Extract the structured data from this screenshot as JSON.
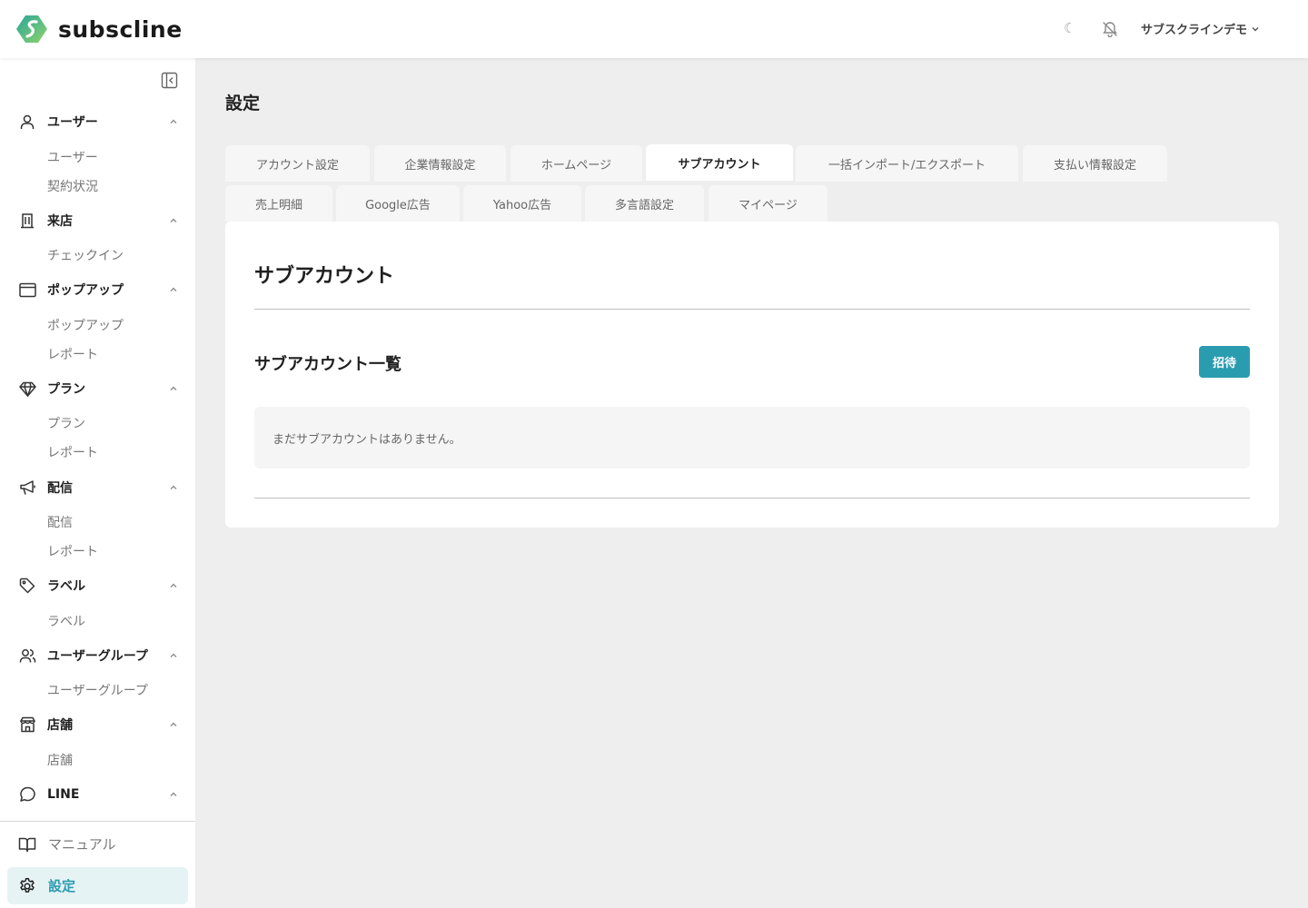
{
  "app": {
    "brand": "subscline",
    "theme_icon": "moon-icon",
    "notification_icon": "bell-off-icon",
    "account_name": "サブスクラインデモ"
  },
  "sidebar": {
    "sections": [
      {
        "icon": "user-icon",
        "label": "ユーザー",
        "items": [
          "ユーザー",
          "契約状況"
        ]
      },
      {
        "icon": "building-icon",
        "label": "来店",
        "items": [
          "チェックイン"
        ]
      },
      {
        "icon": "window-icon",
        "label": "ポップアップ",
        "items": [
          "ポップアップ",
          "レポート"
        ]
      },
      {
        "icon": "gem-icon",
        "label": "プラン",
        "items": [
          "プラン",
          "レポート"
        ]
      },
      {
        "icon": "megaphone-icon",
        "label": "配信",
        "items": [
          "配信",
          "レポート"
        ]
      },
      {
        "icon": "tag-icon",
        "label": "ラベル",
        "items": [
          "ラベル"
        ]
      },
      {
        "icon": "users-icon",
        "label": "ユーザーグループ",
        "items": [
          "ユーザーグループ"
        ]
      },
      {
        "icon": "store-icon",
        "label": "店舗",
        "items": [
          "店舗"
        ]
      },
      {
        "icon": "chat-icon",
        "label": "LINE",
        "items": []
      }
    ],
    "manual_label": "マニュアル",
    "settings_label": "設定"
  },
  "main": {
    "page_title": "設定",
    "tabs": [
      {
        "label": "アカウント設定",
        "active": false
      },
      {
        "label": "企業情報設定",
        "active": false
      },
      {
        "label": "ホームページ",
        "active": false
      },
      {
        "label": "サブアカウント",
        "active": true
      },
      {
        "label": "一括インポート/エクスポート",
        "active": false
      },
      {
        "label": "支払い情報設定",
        "active": false
      },
      {
        "label": "売上明細",
        "active": false
      },
      {
        "label": "Google広告",
        "active": false
      },
      {
        "label": "Yahoo広告",
        "active": false
      },
      {
        "label": "多言語設定",
        "active": false
      },
      {
        "label": "マイページ",
        "active": false
      }
    ],
    "card": {
      "title": "サブアカウント",
      "list_title": "サブアカウント一覧",
      "invite_label": "招待",
      "empty_message": "まだサブアカウントはありません。"
    }
  },
  "colors": {
    "accent": "#2a9cb0",
    "active_bg": "#e6f3f5",
    "page_bg": "#eeeeee"
  }
}
